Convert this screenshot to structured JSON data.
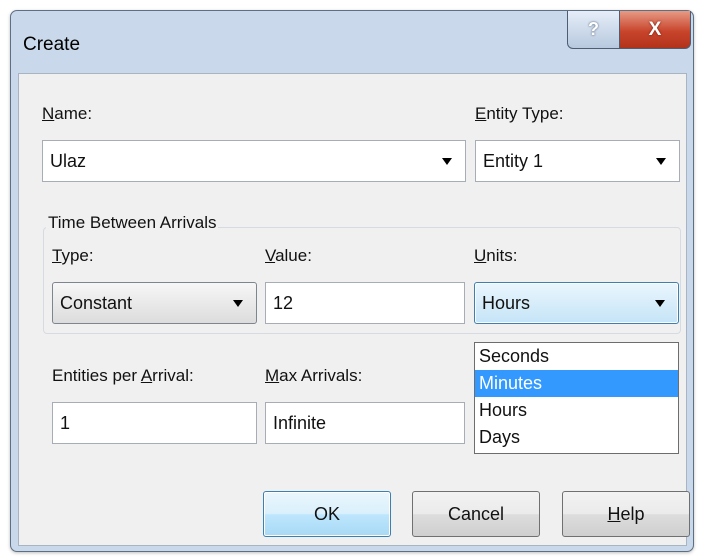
{
  "window": {
    "title": "Create"
  },
  "titlebar": {
    "help_symbol": "?",
    "close_symbol": "X"
  },
  "name": {
    "label_key": "N",
    "label_rest": "ame:",
    "value": "Ulaz"
  },
  "entity_type": {
    "label_key": "E",
    "label_rest": "ntity Type:",
    "value": "Entity 1"
  },
  "group_label": "Time Between Arrivals",
  "type": {
    "label_key": "T",
    "label_rest": "ype:",
    "value": "Constant"
  },
  "value": {
    "label_key": "V",
    "label_rest": "alue:",
    "value": "12"
  },
  "units": {
    "label_key": "U",
    "label_rest": "nits:",
    "value": "Hours",
    "options": [
      "Seconds",
      "Minutes",
      "Hours",
      "Days"
    ],
    "highlighted": "Minutes"
  },
  "entities_per_arrival": {
    "label_pre": "Entities per ",
    "label_key": "A",
    "label_rest": "rrival:",
    "value": "1"
  },
  "max_arrivals": {
    "label_key": "M",
    "label_rest": "ax Arrivals:",
    "value": "Infinite"
  },
  "buttons": {
    "ok": "OK",
    "cancel": "Cancel",
    "help_key": "H",
    "help_rest": "elp"
  },
  "colors": {
    "highlight": "#3399ff",
    "close_button": "#c8452c",
    "focus_border": "#3c7fb1"
  }
}
